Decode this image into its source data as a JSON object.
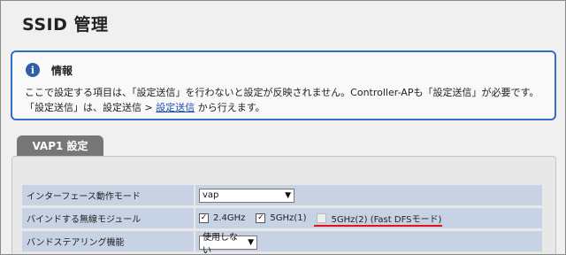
{
  "page": {
    "title": "SSID 管理"
  },
  "info": {
    "title": "情報",
    "line1": "ここで設定する項目は、「設定送信」を行わないと設定が反映されません。Controller-APも「設定送信」が必要です。",
    "line2_prefix": "「設定送信」は、設定送信 > ",
    "line2_link": "設定送信",
    "line2_suffix": " から行えます。"
  },
  "section": {
    "tab_label": "VAP1 設定"
  },
  "rows": [
    {
      "label": "インターフェース動作モード",
      "select_value": "vap"
    },
    {
      "label": "バインドする無線モジュール",
      "options": [
        {
          "label": "2.4GHz",
          "checked": true,
          "check_mark": "✓",
          "enabled": true
        },
        {
          "label": "5GHz(1)",
          "checked": true,
          "check_mark": "✓",
          "enabled": true
        },
        {
          "label": "5GHz(2) (Fast DFSモード)",
          "checked": false,
          "check_mark": "",
          "enabled": false
        }
      ]
    },
    {
      "label": "バンドステアリング機能",
      "select_value": "使用しない"
    }
  ],
  "colors": {
    "info_border": "#2f6fc6",
    "label_bg": "#c7d2e4",
    "tab_bg": "#777777",
    "highlight_underline": "#e0141e"
  }
}
